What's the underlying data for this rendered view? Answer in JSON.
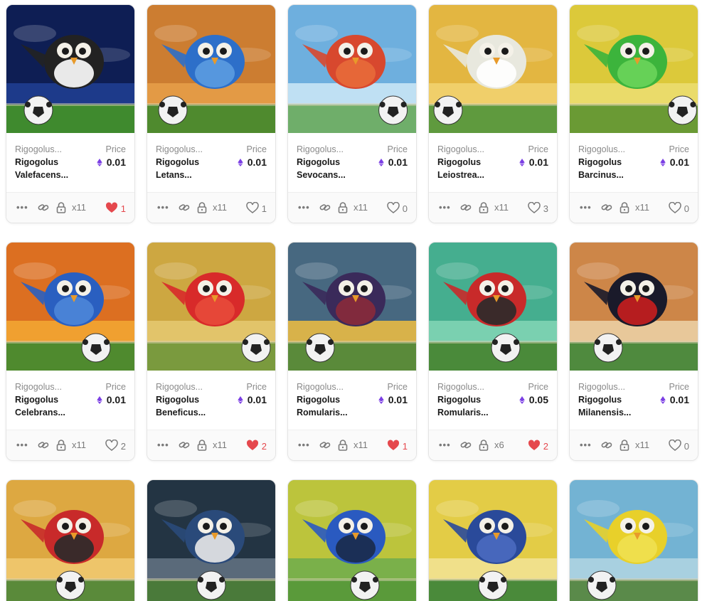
{
  "colors": {
    "accent": "#e5484d",
    "eth": "#7b3fe4",
    "muted": "#8a8a8a"
  },
  "price_label": "Price",
  "icons": {
    "more": "more-dots-icon",
    "link": "link-icon",
    "lock": "lock-icon",
    "heart": "heart-icon",
    "eth": "ethereum-icon"
  },
  "cards": [
    {
      "collection": "Rigogolus...",
      "name_line1": "Rigogolus",
      "name_line2": "Valefacens...",
      "price": "0.01",
      "qty": "x11",
      "likes": "1",
      "liked": true,
      "theme": {
        "bg1": "#0c1a4a",
        "bg2": "#1d3a8a",
        "ground": "#3f8a2e",
        "bird": "#222222",
        "belly": "#ffffff",
        "ball_x": 0.25
      }
    },
    {
      "collection": "Rigogolus...",
      "name_line1": "Rigogolus",
      "name_line2": "Letans...",
      "price": "0.01",
      "qty": "x11",
      "likes": "1",
      "liked": false,
      "theme": {
        "bg1": "#c8782e",
        "bg2": "#e39a45",
        "ground": "#4f8a2e",
        "bird": "#2d6fc9",
        "belly": "#5b9be0",
        "ball_x": 0.2
      }
    },
    {
      "collection": "Rigogolus...",
      "name_line1": "Rigogolus",
      "name_line2": "Sevocans...",
      "price": "0.01",
      "qty": "x11",
      "likes": "0",
      "liked": false,
      "theme": {
        "bg1": "#5fa6d9",
        "bg2": "#bfe0f3",
        "ground": "#6fae6a",
        "bird": "#d8482e",
        "belly": "#e86a3a",
        "ball_x": 0.82
      }
    },
    {
      "collection": "Rigogolus...",
      "name_line1": "Rigogolus",
      "name_line2": "Leiostrea...",
      "price": "0.01",
      "qty": "x11",
      "likes": "3",
      "liked": false,
      "theme": {
        "bg1": "#e0b23a",
        "bg2": "#f0cf6a",
        "ground": "#5f9a3e",
        "bird": "#e8e8de",
        "belly": "#ffffff",
        "ball_x": 0.15
      }
    },
    {
      "collection": "Rigogolus...",
      "name_line1": "Rigogolus",
      "name_line2": "Barcinus...",
      "price": "0.01",
      "qty": "x11",
      "likes": "0",
      "liked": false,
      "theme": {
        "bg1": "#d9c531",
        "bg2": "#eadb6a",
        "ground": "#6a9a34",
        "bird": "#3cb43c",
        "belly": "#6ad45a",
        "ball_x": 0.88
      }
    },
    {
      "collection": "Rigogolus...",
      "name_line1": "Rigogolus",
      "name_line2": "Celebrans...",
      "price": "0.01",
      "qty": "x11",
      "likes": "2",
      "liked": false,
      "theme": {
        "bg1": "#d8661e",
        "bg2": "#f0a030",
        "ground": "#4f8a2e",
        "bird": "#2a5fc0",
        "belly": "#4d86d8",
        "ball_x": 0.7
      }
    },
    {
      "collection": "Rigogolus...",
      "name_line1": "Rigogolus",
      "name_line2": "Beneficus...",
      "price": "0.01",
      "qty": "x11",
      "likes": "2",
      "liked": true,
      "theme": {
        "bg1": "#c9a23a",
        "bg2": "#e2c46a",
        "ground": "#7a9a3e",
        "bird": "#d82a2a",
        "belly": "#e84a3a",
        "ball_x": 0.85
      }
    },
    {
      "collection": "Rigogolus...",
      "name_line1": "Rigogolus",
      "name_line2": "Romularis...",
      "price": "0.01",
      "qty": "x11",
      "likes": "1",
      "liked": true,
      "theme": {
        "bg1": "#2e5a8a",
        "bg2": "#d8b24a",
        "ground": "#5a8a3a",
        "bird": "#3a2a5a",
        "belly": "#8a2a3a",
        "ball_x": 0.25
      }
    },
    {
      "collection": "Rigogolus...",
      "name_line1": "Rigogolus",
      "name_line2": "Romularis...",
      "price": "0.05",
      "qty": "x6",
      "likes": "2",
      "liked": true,
      "theme": {
        "bg1": "#3ca88a",
        "bg2": "#7ad0b0",
        "ground": "#4a8a3a",
        "bird": "#c82a2a",
        "belly": "#2a2a2a",
        "ball_x": 0.6
      }
    },
    {
      "collection": "Rigogolus...",
      "name_line1": "Rigogolus",
      "name_line2": "Milanensis...",
      "price": "0.01",
      "qty": "x11",
      "likes": "0",
      "liked": false,
      "theme": {
        "bg1": "#c87a3a",
        "bg2": "#e8c89a",
        "ground": "#4f8a3e",
        "bird": "#1a1a2a",
        "belly": "#c81e1e",
        "ball_x": 0.3
      }
    }
  ],
  "partial_cards": [
    {
      "theme": {
        "bg1": "#d9a23a",
        "bg2": "#eec56a",
        "ground": "#5a8a3a",
        "bird": "#c82a2a",
        "belly": "#2a2a2a",
        "ball_x": 0.5
      }
    },
    {
      "theme": {
        "bg1": "#1a2a3a",
        "bg2": "#5a6a7a",
        "ground": "#4a7a3a",
        "bird": "#2a4a7a",
        "belly": "#e8e8e8",
        "ball_x": 0.5
      }
    },
    {
      "theme": {
        "bg1": "#c8c83a",
        "bg2": "#7ab04a",
        "ground": "#5a9a3a",
        "bird": "#2a5ac0",
        "belly": "#1a2a4a",
        "ball_x": 0.6
      }
    },
    {
      "theme": {
        "bg1": "#e0c83a",
        "bg2": "#f0e08a",
        "ground": "#4a8a3a",
        "bird": "#2a4a9a",
        "belly": "#4a6ac0",
        "ball_x": 0.5
      }
    },
    {
      "theme": {
        "bg1": "#6aaed0",
        "bg2": "#a8d0e0",
        "ground": "#5a8a4a",
        "bird": "#e8d02a",
        "belly": "#f0e050",
        "ball_x": 0.25
      }
    }
  ]
}
